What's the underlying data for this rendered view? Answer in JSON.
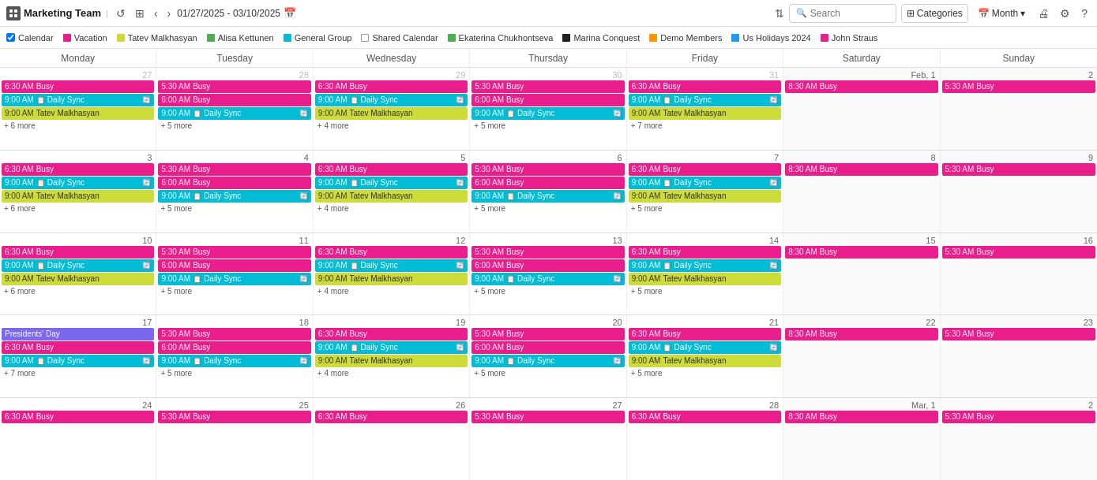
{
  "topbar": {
    "team_name": "Marketing Team",
    "date_range": "01/27/2025 - 03/10/2025",
    "search_placeholder": "Search",
    "categories_label": "Categories",
    "month_label": "Month",
    "sort_icon": "⇅",
    "nav_prev": "‹",
    "nav_next": "›",
    "undo_icon": "↺",
    "view_icon": "⊞",
    "cal_icon": "📅",
    "chevron_down": "▾",
    "print_icon": "🖨",
    "settings_icon": "⚙",
    "help_icon": "?"
  },
  "legend": [
    {
      "label": "Calendar",
      "color": "border",
      "hex": ""
    },
    {
      "label": "Vacation",
      "color": "solid",
      "hex": "#e91e8c"
    },
    {
      "label": "Tatev Malkhasyan",
      "color": "solid",
      "hex": "#cddc39"
    },
    {
      "label": "Alisa Kettunen",
      "color": "solid",
      "hex": "#4caf50"
    },
    {
      "label": "General Group",
      "color": "solid",
      "hex": "#00bcd4"
    },
    {
      "label": "Shared Calendar",
      "color": "border",
      "hex": ""
    },
    {
      "label": "Ekaterina Chukhontseva",
      "color": "solid",
      "hex": "#4caf50"
    },
    {
      "label": "Marina Conquest",
      "color": "solid",
      "hex": "#212121"
    },
    {
      "label": "Demo Members",
      "color": "solid",
      "hex": "#ff9800"
    },
    {
      "label": "Us Holidays 2024",
      "color": "solid",
      "hex": "#2196f3"
    },
    {
      "label": "John Straus",
      "color": "solid",
      "hex": "#e91e8c"
    }
  ],
  "day_headers": [
    "Monday",
    "Tuesday",
    "Wednesday",
    "Thursday",
    "Friday",
    "Saturday",
    "Sunday"
  ],
  "weeks": [
    {
      "days": [
        {
          "num": "27",
          "other": true,
          "events": [
            {
              "time": "6:30 AM",
              "title": "Busy",
              "color": "ev-pink"
            },
            {
              "time": "9:00 AM",
              "title": "Daily Sync",
              "color": "ev-cyan",
              "icon": "📋",
              "sync": true
            },
            {
              "time": "9:00 AM",
              "title": "Tatev Malkhasyan",
              "color": "ev-lime"
            }
          ],
          "more": "+ 6 more"
        },
        {
          "num": "28",
          "other": true,
          "events": [
            {
              "time": "5:30 AM",
              "title": "Busy",
              "color": "ev-pink"
            },
            {
              "time": "6:00 AM",
              "title": "Busy",
              "color": "ev-pink"
            },
            {
              "time": "9:00 AM",
              "title": "Daily Sync",
              "color": "ev-cyan",
              "icon": "📋",
              "sync": true
            }
          ],
          "more": "+ 5 more"
        },
        {
          "num": "29",
          "other": true,
          "events": [
            {
              "time": "6:30 AM",
              "title": "Busy",
              "color": "ev-pink"
            },
            {
              "time": "9:00 AM",
              "title": "Daily Sync",
              "color": "ev-cyan",
              "icon": "📋",
              "sync": true
            },
            {
              "time": "9:00 AM",
              "title": "Tatev Malkhasyan",
              "color": "ev-lime"
            }
          ],
          "more": "+ 4 more"
        },
        {
          "num": "30",
          "other": true,
          "events": [
            {
              "time": "5:30 AM",
              "title": "Busy",
              "color": "ev-pink"
            },
            {
              "time": "6:00 AM",
              "title": "Busy",
              "color": "ev-pink"
            },
            {
              "time": "9:00 AM",
              "title": "Daily Sync",
              "color": "ev-cyan",
              "icon": "📋",
              "sync": true
            }
          ],
          "more": "+ 5 more"
        },
        {
          "num": "31",
          "other": true,
          "events": [
            {
              "time": "6:30 AM",
              "title": "Busy",
              "color": "ev-pink"
            },
            {
              "time": "9:00 AM",
              "title": "Daily Sync",
              "color": "ev-cyan",
              "icon": "📋",
              "sync": true
            },
            {
              "time": "9:00 AM",
              "title": "Tatev Malkhasyan",
              "color": "ev-lime"
            }
          ],
          "more": "+ 7 more"
        },
        {
          "num": "Feb, 1",
          "other": false,
          "sat": true,
          "events": [
            {
              "time": "8:30 AM",
              "title": "Busy",
              "color": "ev-pink"
            }
          ],
          "more": ""
        },
        {
          "num": "2",
          "other": false,
          "sun": true,
          "events": [
            {
              "time": "5:30 AM",
              "title": "Busy",
              "color": "ev-pink"
            }
          ],
          "more": ""
        }
      ]
    },
    {
      "days": [
        {
          "num": "3",
          "other": false,
          "events": [
            {
              "time": "6:30 AM",
              "title": "Busy",
              "color": "ev-pink"
            },
            {
              "time": "9:00 AM",
              "title": "Daily Sync",
              "color": "ev-cyan",
              "icon": "📋",
              "sync": true
            },
            {
              "time": "9:00 AM",
              "title": "Tatev Malkhasyan",
              "color": "ev-lime"
            }
          ],
          "more": "+ 6 more"
        },
        {
          "num": "4",
          "other": false,
          "events": [
            {
              "time": "5:30 AM",
              "title": "Busy",
              "color": "ev-pink"
            },
            {
              "time": "6:00 AM",
              "title": "Busy",
              "color": "ev-pink"
            },
            {
              "time": "9:00 AM",
              "title": "Daily Sync",
              "color": "ev-cyan",
              "icon": "📋",
              "sync": true
            }
          ],
          "more": "+ 5 more"
        },
        {
          "num": "5",
          "other": false,
          "events": [
            {
              "time": "6:30 AM",
              "title": "Busy",
              "color": "ev-pink"
            },
            {
              "time": "9:00 AM",
              "title": "Daily Sync",
              "color": "ev-cyan",
              "icon": "📋",
              "sync": true
            },
            {
              "time": "9:00 AM",
              "title": "Tatev Malkhasyan",
              "color": "ev-lime"
            }
          ],
          "more": "+ 4 more"
        },
        {
          "num": "6",
          "other": false,
          "events": [
            {
              "time": "5:30 AM",
              "title": "Busy",
              "color": "ev-pink"
            },
            {
              "time": "6:00 AM",
              "title": "Busy",
              "color": "ev-pink"
            },
            {
              "time": "9:00 AM",
              "title": "Daily Sync",
              "color": "ev-cyan",
              "icon": "📋",
              "sync": true
            }
          ],
          "more": "+ 5 more"
        },
        {
          "num": "7",
          "other": false,
          "events": [
            {
              "time": "6:30 AM",
              "title": "Busy",
              "color": "ev-pink"
            },
            {
              "time": "9:00 AM",
              "title": "Daily Sync",
              "color": "ev-cyan",
              "icon": "📋",
              "sync": true
            },
            {
              "time": "9:00 AM",
              "title": "Tatev Malkhasyan",
              "color": "ev-lime"
            }
          ],
          "more": "+ 5 more"
        },
        {
          "num": "8",
          "other": false,
          "sat": true,
          "events": [
            {
              "time": "8:30 AM",
              "title": "Busy",
              "color": "ev-pink"
            }
          ],
          "more": ""
        },
        {
          "num": "9",
          "other": false,
          "sun": true,
          "events": [
            {
              "time": "5:30 AM",
              "title": "Busy",
              "color": "ev-pink"
            }
          ],
          "more": ""
        }
      ]
    },
    {
      "days": [
        {
          "num": "10",
          "other": false,
          "events": [
            {
              "time": "6:30 AM",
              "title": "Busy",
              "color": "ev-pink"
            },
            {
              "time": "9:00 AM",
              "title": "Daily Sync",
              "color": "ev-cyan",
              "icon": "📋",
              "sync": true
            },
            {
              "time": "9:00 AM",
              "title": "Tatev Malkhasyan",
              "color": "ev-lime"
            }
          ],
          "more": "+ 6 more"
        },
        {
          "num": "11",
          "other": false,
          "events": [
            {
              "time": "5:30 AM",
              "title": "Busy",
              "color": "ev-pink"
            },
            {
              "time": "6:00 AM",
              "title": "Busy",
              "color": "ev-pink"
            },
            {
              "time": "9:00 AM",
              "title": "Daily Sync",
              "color": "ev-cyan",
              "icon": "📋",
              "sync": true
            }
          ],
          "more": "+ 5 more"
        },
        {
          "num": "12",
          "other": false,
          "events": [
            {
              "time": "6:30 AM",
              "title": "Busy",
              "color": "ev-pink"
            },
            {
              "time": "9:00 AM",
              "title": "Daily Sync",
              "color": "ev-cyan",
              "icon": "📋",
              "sync": true
            },
            {
              "time": "9:00 AM",
              "title": "Tatev Malkhasyan",
              "color": "ev-lime"
            }
          ],
          "more": "+ 4 more"
        },
        {
          "num": "13",
          "other": false,
          "events": [
            {
              "time": "5:30 AM",
              "title": "Busy",
              "color": "ev-pink"
            },
            {
              "time": "6:00 AM",
              "title": "Busy",
              "color": "ev-pink"
            },
            {
              "time": "9:00 AM",
              "title": "Daily Sync",
              "color": "ev-cyan",
              "icon": "📋",
              "sync": true
            }
          ],
          "more": "+ 5 more"
        },
        {
          "num": "14",
          "other": false,
          "events": [
            {
              "time": "6:30 AM",
              "title": "Busy",
              "color": "ev-pink"
            },
            {
              "time": "9:00 AM",
              "title": "Daily Sync",
              "color": "ev-cyan",
              "icon": "📋",
              "sync": true
            },
            {
              "time": "9:00 AM",
              "title": "Tatev Malkhasyan",
              "color": "ev-lime"
            }
          ],
          "more": "+ 5 more"
        },
        {
          "num": "15",
          "other": false,
          "sat": true,
          "events": [
            {
              "time": "8:30 AM",
              "title": "Busy",
              "color": "ev-pink"
            }
          ],
          "more": ""
        },
        {
          "num": "16",
          "other": false,
          "sun": true,
          "events": [
            {
              "time": "5:30 AM",
              "title": "Busy",
              "color": "ev-pink"
            }
          ],
          "more": ""
        }
      ]
    },
    {
      "days": [
        {
          "num": "17",
          "other": false,
          "holiday": "Presidents' Day",
          "events": [
            {
              "time": "6:30 AM",
              "title": "Busy",
              "color": "ev-pink"
            },
            {
              "time": "9:00 AM",
              "title": "Daily Sync",
              "color": "ev-cyan",
              "icon": "📋",
              "sync": true
            }
          ],
          "more": "+ 7 more"
        },
        {
          "num": "18",
          "other": false,
          "events": [
            {
              "time": "5:30 AM",
              "title": "Busy",
              "color": "ev-pink"
            },
            {
              "time": "6:00 AM",
              "title": "Busy",
              "color": "ev-pink"
            },
            {
              "time": "9:00 AM",
              "title": "Daily Sync",
              "color": "ev-cyan",
              "icon": "📋",
              "sync": true
            }
          ],
          "more": "+ 5 more"
        },
        {
          "num": "19",
          "other": false,
          "events": [
            {
              "time": "6:30 AM",
              "title": "Busy",
              "color": "ev-pink"
            },
            {
              "time": "9:00 AM",
              "title": "Daily Sync",
              "color": "ev-cyan",
              "icon": "📋",
              "sync": true
            },
            {
              "time": "9:00 AM",
              "title": "Tatev Malkhasyan",
              "color": "ev-lime"
            }
          ],
          "more": "+ 4 more"
        },
        {
          "num": "20",
          "other": false,
          "events": [
            {
              "time": "5:30 AM",
              "title": "Busy",
              "color": "ev-pink"
            },
            {
              "time": "6:00 AM",
              "title": "Busy",
              "color": "ev-pink"
            },
            {
              "time": "9:00 AM",
              "title": "Daily Sync",
              "color": "ev-cyan",
              "icon": "📋",
              "sync": true
            }
          ],
          "more": "+ 5 more"
        },
        {
          "num": "21",
          "other": false,
          "events": [
            {
              "time": "6:30 AM",
              "title": "Busy",
              "color": "ev-pink"
            },
            {
              "time": "9:00 AM",
              "title": "Daily Sync",
              "color": "ev-cyan",
              "icon": "📋",
              "sync": true
            },
            {
              "time": "9:00 AM",
              "title": "Tatev Malkhasyan",
              "color": "ev-lime"
            }
          ],
          "more": "+ 5 more"
        },
        {
          "num": "22",
          "other": false,
          "sat": true,
          "events": [
            {
              "time": "8:30 AM",
              "title": "Busy",
              "color": "ev-pink"
            }
          ],
          "more": ""
        },
        {
          "num": "23",
          "other": false,
          "sun": true,
          "events": [
            {
              "time": "5:30 AM",
              "title": "Busy",
              "color": "ev-pink"
            }
          ],
          "more": ""
        }
      ]
    },
    {
      "days": [
        {
          "num": "24",
          "other": false,
          "events": [
            {
              "time": "6:30 AM",
              "title": "Busy",
              "color": "ev-pink"
            }
          ],
          "more": "",
          "partial": true
        },
        {
          "num": "25",
          "other": false,
          "events": [
            {
              "time": "5:30 AM",
              "title": "Busy",
              "color": "ev-pink"
            }
          ],
          "more": "",
          "partial": true
        },
        {
          "num": "26",
          "other": false,
          "events": [
            {
              "time": "6:30 AM",
              "title": "Busy",
              "color": "ev-pink"
            }
          ],
          "more": "",
          "partial": true
        },
        {
          "num": "27",
          "other": false,
          "events": [
            {
              "time": "5:30 AM",
              "title": "Busy",
              "color": "ev-pink"
            }
          ],
          "more": "",
          "partial": true
        },
        {
          "num": "28",
          "other": false,
          "events": [
            {
              "time": "6:30 AM",
              "title": "Busy",
              "color": "ev-pink"
            }
          ],
          "more": "",
          "partial": true
        },
        {
          "num": "Mar, 1",
          "other": false,
          "sat": true,
          "events": [
            {
              "time": "8:30 AM",
              "title": "Busy",
              "color": "ev-pink"
            }
          ],
          "more": ""
        },
        {
          "num": "2",
          "other": false,
          "sun": true,
          "events": [
            {
              "time": "5:30 AM",
              "title": "Busy",
              "color": "ev-pink"
            }
          ],
          "more": ""
        }
      ]
    }
  ]
}
